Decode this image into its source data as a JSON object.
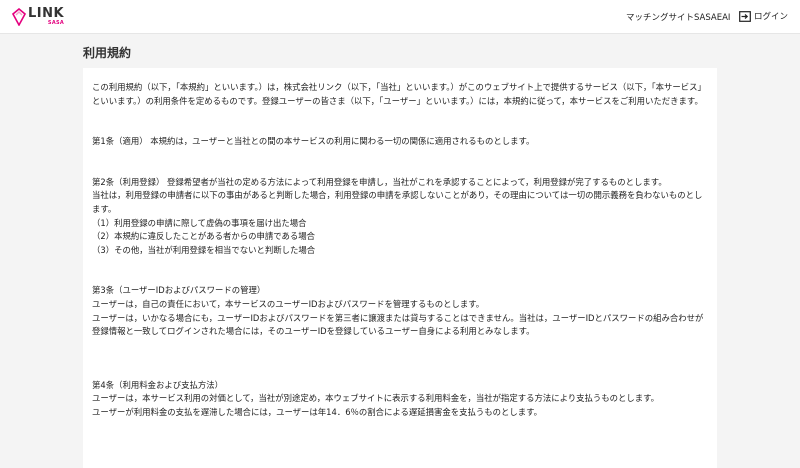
{
  "header": {
    "logo_text": "LINK",
    "logo_sub": "SASA",
    "nav_link": "マッチングサイトSASAEAI",
    "login_label": "ログイン"
  },
  "page": {
    "title": "利用規約"
  },
  "terms": {
    "intro": "この利用規約（以下，「本規約」といいます。）は，株式会社リンク（以下，「当社」といいます。）がこのウェブサイト上で提供するサービス（以下，「本サービス」といいます。）の利用条件を定めるものです。登録ユーザーの皆さま（以下，「ユーザー」といいます。）には，本規約に従って，本サービスをご利用いただきます。",
    "art1": "第1条（適用） 本規約は，ユーザーと当社との間の本サービスの利用に関わる一切の関係に適用されるものとします。",
    "art2_l1": "第2条（利用登録） 登録希望者が当社の定める方法によって利用登録を申請し，当社がこれを承認することによって，利用登録が完了するものとします。",
    "art2_l2": "当社は，利用登録の申請者に以下の事由があると判断した場合，利用登録の申請を承認しないことがあり，その理由については一切の開示義務を負わないものとします。",
    "art2_i1": "（1）利用登録の申請に際して虚偽の事項を届け出た場合",
    "art2_i2": "（2）本規約に違反したことがある者からの申請である場合",
    "art2_i3": "（3）その他，当社が利用登録を相当でないと判断した場合",
    "art3_title": "第3条（ユーザーIDおよびパスワードの管理）",
    "art3_l1": "ユーザーは，自己の責任において，本サービスのユーザーIDおよびパスワードを管理するものとします。",
    "art3_l2": "ユーザーは，いかなる場合にも，ユーザーIDおよびパスワードを第三者に譲渡または貸与することはできません。当社は，ユーザーIDとパスワードの組み合わせが登録情報と一致してログインされた場合には，そのユーザーIDを登録しているユーザー自身による利用とみなします。",
    "art4_title": "第4条（利用料金および支払方法）",
    "art4_l1": "ユーザーは，本サービス利用の対価として，当社が別途定め，本ウェブサイトに表示する利用料金を，当社が指定する方法により支払うものとします。",
    "art4_l2": "ユーザーが利用料金の支払を遅滞した場合には，ユーザーは年14．6％の割合による遅延損害金を支払うものとします。"
  },
  "colors": {
    "brand_accent": "#e4007f",
    "background": "#f4f4f4"
  }
}
